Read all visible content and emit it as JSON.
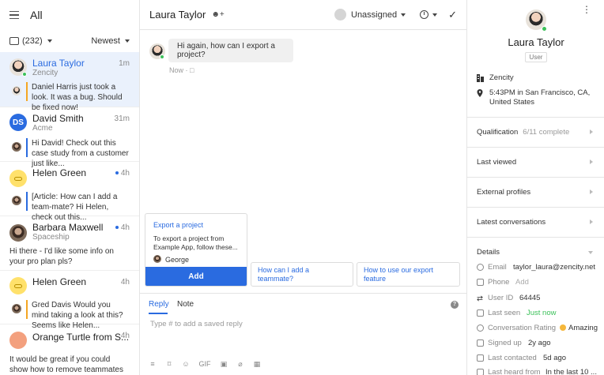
{
  "left": {
    "title": "All",
    "inbox_count": "(232)",
    "sort_label": "Newest",
    "conversations": [
      {
        "name": "Laura Taylor",
        "time": "1m",
        "company": "Zencity",
        "preview": "Daniel Harris just took a look. It was a bug. Should be fixed now!"
      },
      {
        "name": "David Smith",
        "time": "31m",
        "company": "Acme",
        "initials": "DS",
        "preview": "Hi David! Check out this case study from a customer just like..."
      },
      {
        "name": "Helen Green",
        "time": "4h",
        "company": "",
        "preview": "[Article: How can I add a team-mate? Hi Helen, check out this..."
      },
      {
        "name": "Barbara Maxwell",
        "time": "4h",
        "company": "Spaceship",
        "preview": "Hi there - I'd like some info on your pro plan pls?"
      },
      {
        "name": "Helen Green",
        "time": "4h",
        "company": "",
        "preview": "Gred Davis Would you mind taking a look at this? Seems like Helen..."
      },
      {
        "name": "Orange Turtle from S...",
        "time": "4h",
        "company": "",
        "preview": "It would be great if you could show how to remove teammates too. Thanks!"
      }
    ]
  },
  "middle": {
    "contact_name": "Laura Taylor",
    "assignee": "Unassigned",
    "message": "Hi again, how can I export a project?",
    "message_meta": "Now · ",
    "suggestion": {
      "title": "Export a project",
      "body": "To export a project from Example App, follow these...",
      "author": "George",
      "add_label": "Add"
    },
    "chips": [
      "How can I add a teammate?",
      "How to use our export feature"
    ],
    "composer": {
      "tab_reply": "Reply",
      "tab_note": "Note",
      "placeholder": "Type # to add a saved reply",
      "help": "?",
      "tools": [
        "≡",
        "⌑",
        "☺",
        "GIF",
        "▣",
        "⌀",
        "▦"
      ]
    }
  },
  "right": {
    "name": "Laura Taylor",
    "role": "User",
    "company": "Zencity",
    "location": "5:43PM in San Francisco, CA, United States",
    "sections": [
      {
        "label": "Qualification",
        "value": "6/11 complete"
      },
      {
        "label": "Last viewed",
        "value": ""
      },
      {
        "label": "External profiles",
        "value": ""
      },
      {
        "label": "Latest conversations",
        "value": ""
      },
      {
        "label": "Details",
        "value": ""
      }
    ],
    "details": [
      {
        "label": "Email",
        "value": "taylor_laura@zencity.net"
      },
      {
        "label": "Phone",
        "value": "Add"
      },
      {
        "label": "User ID",
        "value": "64445"
      },
      {
        "label": "Last seen",
        "value": "Just now"
      },
      {
        "label": "Conversation Rating",
        "value": "Amazing"
      },
      {
        "label": "Signed up",
        "value": "2y ago"
      },
      {
        "label": "Last contacted",
        "value": "5d ago"
      },
      {
        "label": "Last heard from",
        "value": "In the last 10 ..."
      }
    ]
  },
  "colors": {
    "accent": "#2a6be0",
    "online": "#3cc15a",
    "note_bar": "#f5a623",
    "active_row": "#eaf1fc"
  }
}
